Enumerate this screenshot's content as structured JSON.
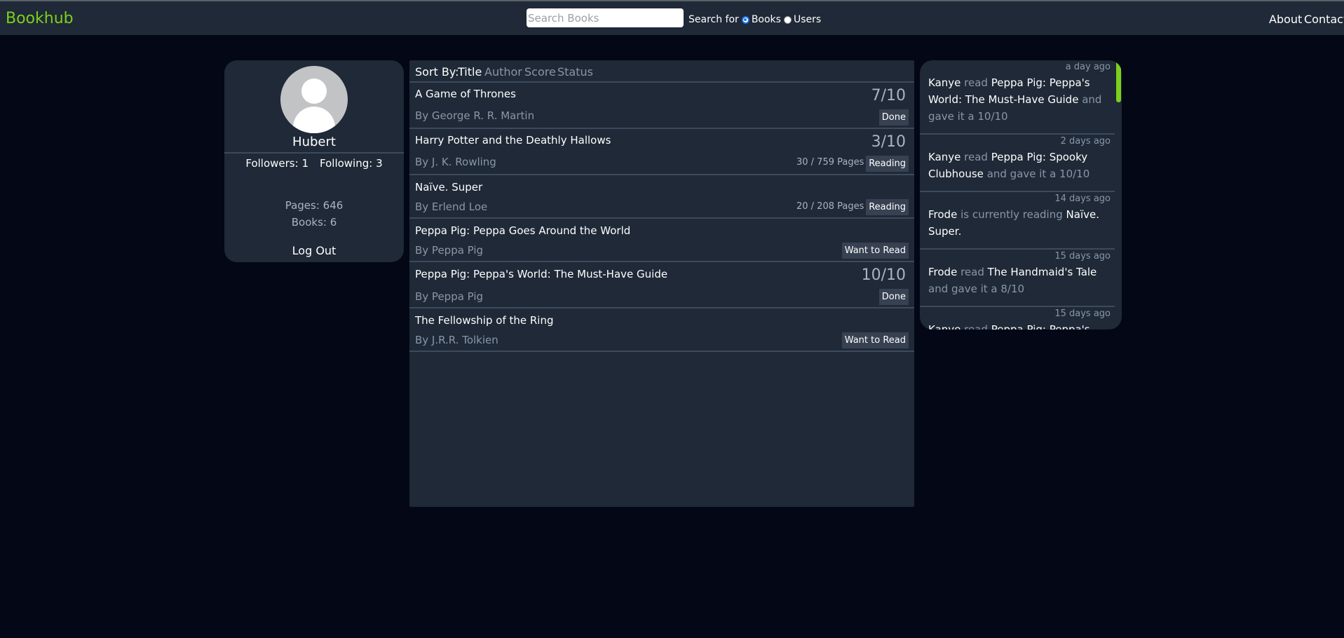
{
  "navbar": {
    "brand": "Bookhub",
    "search_placeholder": "Search Books",
    "search_for_label": "Search for",
    "radio_books": "Books",
    "radio_users": "Users",
    "about": "About",
    "contact": "Contact"
  },
  "profile": {
    "username": "Hubert",
    "followers": "Followers: 1",
    "following": "Following: 3",
    "pages": "Pages: 646",
    "books": "Books: 6",
    "logout": "Log Out"
  },
  "sort": {
    "label": "Sort By:",
    "title": "Title",
    "author": "Author",
    "score": "Score",
    "status": "Status"
  },
  "books": [
    {
      "title": "A Game of Thrones",
      "author": "By George R. R. Martin",
      "score": "7/10",
      "status": "Done"
    },
    {
      "title": "Harry Potter and the Deathly Hallows",
      "author": "By J. K. Rowling",
      "score": "3/10",
      "pages": "30 / 759 Pages",
      "status": "Reading"
    },
    {
      "title": "Naïve. Super",
      "author": "By Erlend Loe",
      "pages": "20 / 208 Pages",
      "status": "Reading"
    },
    {
      "title": "Peppa Pig: Peppa Goes Around the World",
      "author": "By Peppa Pig",
      "status": "Want to Read"
    },
    {
      "title": "Peppa Pig: Peppa's World: The Must-Have Guide",
      "author": "By Peppa Pig",
      "score": "10/10",
      "status": "Done"
    },
    {
      "title": "The Fellowship of the Ring",
      "author": "By J.R.R. Tolkien",
      "status": "Want to Read"
    }
  ],
  "feed": [
    {
      "time": "a day ago",
      "user": "Kanye",
      "verb": "read",
      "book": "Peppa Pig: Peppa's World: The Must-Have Guide",
      "tail": "and gave it a 10/10"
    },
    {
      "time": "2 days ago",
      "user": "Kanye",
      "verb": "read",
      "book": "Peppa Pig: Spooky Clubhouse",
      "tail": "and gave it a 10/10"
    },
    {
      "time": "14 days ago",
      "user": "Frode",
      "verb": "is currently reading",
      "book": "Naïve. Super."
    },
    {
      "time": "15 days ago",
      "user": "Frode",
      "verb": "read",
      "book": "The Handmaid's Tale",
      "tail": "and gave it a 8/10"
    },
    {
      "time": "15 days ago",
      "user": "Kanye",
      "verb": "read",
      "book": "Peppa Pig: Peppa's"
    }
  ]
}
